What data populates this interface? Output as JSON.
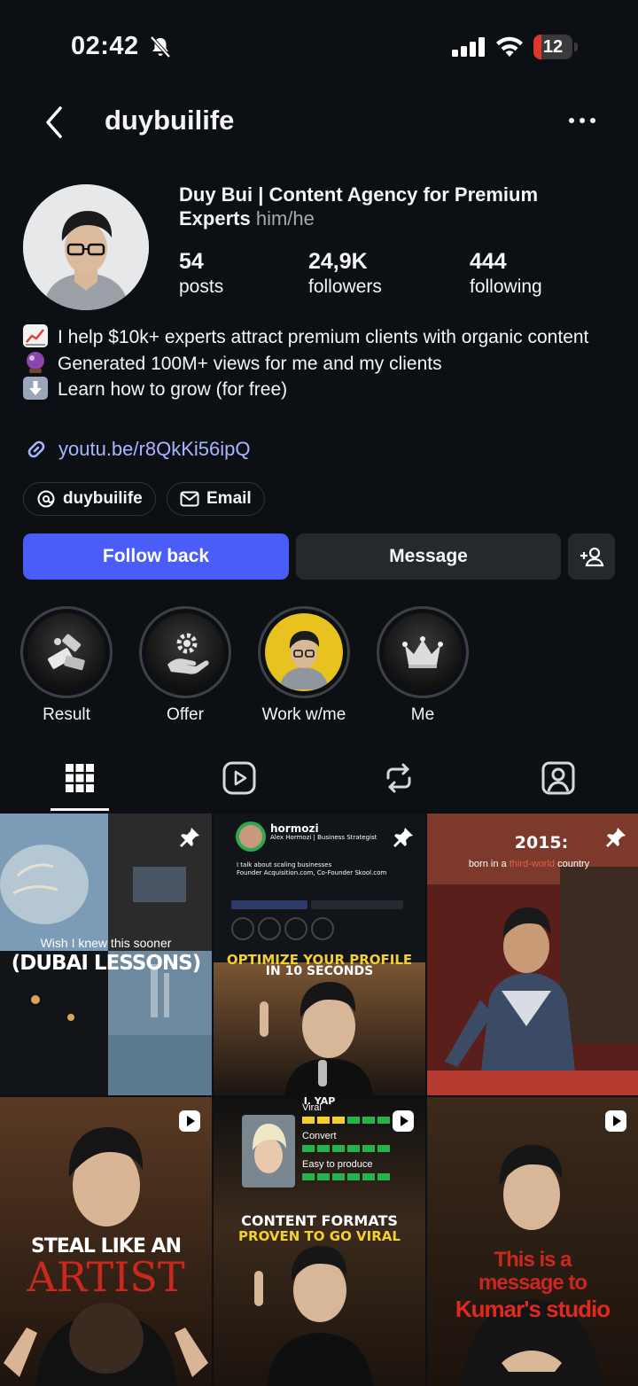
{
  "status_bar": {
    "time": "02:42",
    "battery": "12",
    "battery_level": 0.12
  },
  "header": {
    "username": "duybuilife"
  },
  "profile": {
    "full_name": "Duy Bui | Content Agency for Premium Experts",
    "pronouns": "him/he",
    "stats": [
      {
        "value": "54",
        "label": "posts"
      },
      {
        "value": "24,9K",
        "label": "followers"
      },
      {
        "value": "444",
        "label": "following"
      }
    ],
    "bio": [
      {
        "emoji": "chart-increasing-emoji",
        "text": "I help $10k+ experts attract premium clients with organic content"
      },
      {
        "emoji": "crystal-ball-emoji",
        "text": "Generated 100M+ views for me and my clients"
      },
      {
        "emoji": "down-arrow-emoji",
        "text": "Learn how to grow (for free)"
      }
    ],
    "link": "youtu.be/r8QkKi56ipQ",
    "threads_chip": "duybuilife",
    "email_chip": "Email"
  },
  "actions": {
    "follow": "Follow back",
    "message": "Message"
  },
  "highlights": [
    {
      "label": "Result",
      "icon": "money-icon"
    },
    {
      "label": "Offer",
      "icon": "gear-hand-icon"
    },
    {
      "label": "Work w/me",
      "icon": "profile-photo"
    },
    {
      "label": "Me",
      "icon": "crown-icon"
    }
  ],
  "tabs": [
    "grid-icon",
    "reels-icon",
    "reposts-icon",
    "tagged-icon"
  ],
  "posts": [
    {
      "caption_top": "Wish I knew this sooner",
      "caption": "(DUBAI LESSONS)",
      "badge": "pin-icon"
    },
    {
      "overlay_name": "hormozi",
      "overlay_sub": "Alex Hormozi | Business Strategist",
      "overlay_bio": "I talk about scaling businesses",
      "overlay_bio2": "Founder Acquisition.com, Co-Founder Skool.com",
      "caption": "OPTIMIZE YOUR PROFILE",
      "caption2": "IN 10 SECONDS",
      "badge": "pin-icon"
    },
    {
      "caption": "2015:",
      "caption_sub_a": "born in a ",
      "caption_sub_b": "third-world",
      "caption_sub_c": " country",
      "badge": "pin-icon"
    },
    {
      "caption": "STEAL LIKE AN",
      "caption2": "ARTIST",
      "badge": "reel-icon"
    },
    {
      "top_label": "I. YAP",
      "rows": [
        "Viral",
        "Convert",
        "Easy to produce"
      ],
      "caption": "CONTENT FORMATS",
      "caption2": "PROVEN TO GO VIRAL",
      "badge": "reel-icon"
    },
    {
      "caption": "This is a",
      "caption2": "message to",
      "caption3": "Kumar's studio",
      "badge": "reel-icon"
    }
  ],
  "colors": {
    "background": "#0c1014",
    "accent": "#4a5df9",
    "link": "#a5b6ff",
    "secondary_button": "#25292e"
  }
}
